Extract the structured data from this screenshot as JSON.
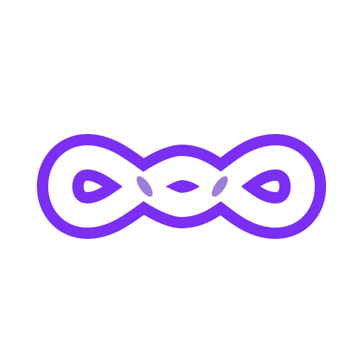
{
  "logo": {
    "icon": "interlaced-infinity-knot-icon",
    "accent_color": "#7b2ff2",
    "shadow_color": "#4b12b8",
    "background_color": "#ffffff"
  }
}
